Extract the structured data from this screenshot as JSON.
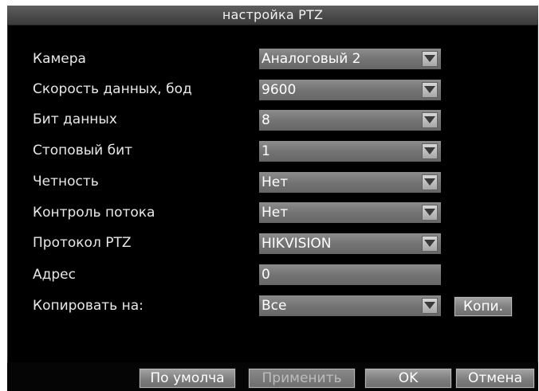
{
  "dialog": {
    "title": "настройка PTZ"
  },
  "form": {
    "rows": [
      {
        "label": "Камера",
        "value": "Аналоговый 2"
      },
      {
        "label": "Скорость данных, бод",
        "value": "9600"
      },
      {
        "label": "Бит данных",
        "value": "8"
      },
      {
        "label": "Стоповый бит",
        "value": "1"
      },
      {
        "label": "Четность",
        "value": "Нет"
      },
      {
        "label": "Контроль потока",
        "value": "Нет"
      },
      {
        "label": "Протокол PTZ",
        "value": "HIKVISION"
      },
      {
        "label": "Адрес",
        "value": "0"
      },
      {
        "label": "Копировать на:",
        "value": "Все"
      }
    ],
    "copy_button": "Копи."
  },
  "footer": {
    "default_button": "По умолча",
    "apply_button": "Применить",
    "ok_button": "OK",
    "cancel_button": "Отмена"
  },
  "icons": {
    "dropdown": "chevron-down-icon"
  },
  "colors": {
    "background": "#000000",
    "field": "#747474",
    "button": "#8e8e8e",
    "text": "#ffffff"
  }
}
